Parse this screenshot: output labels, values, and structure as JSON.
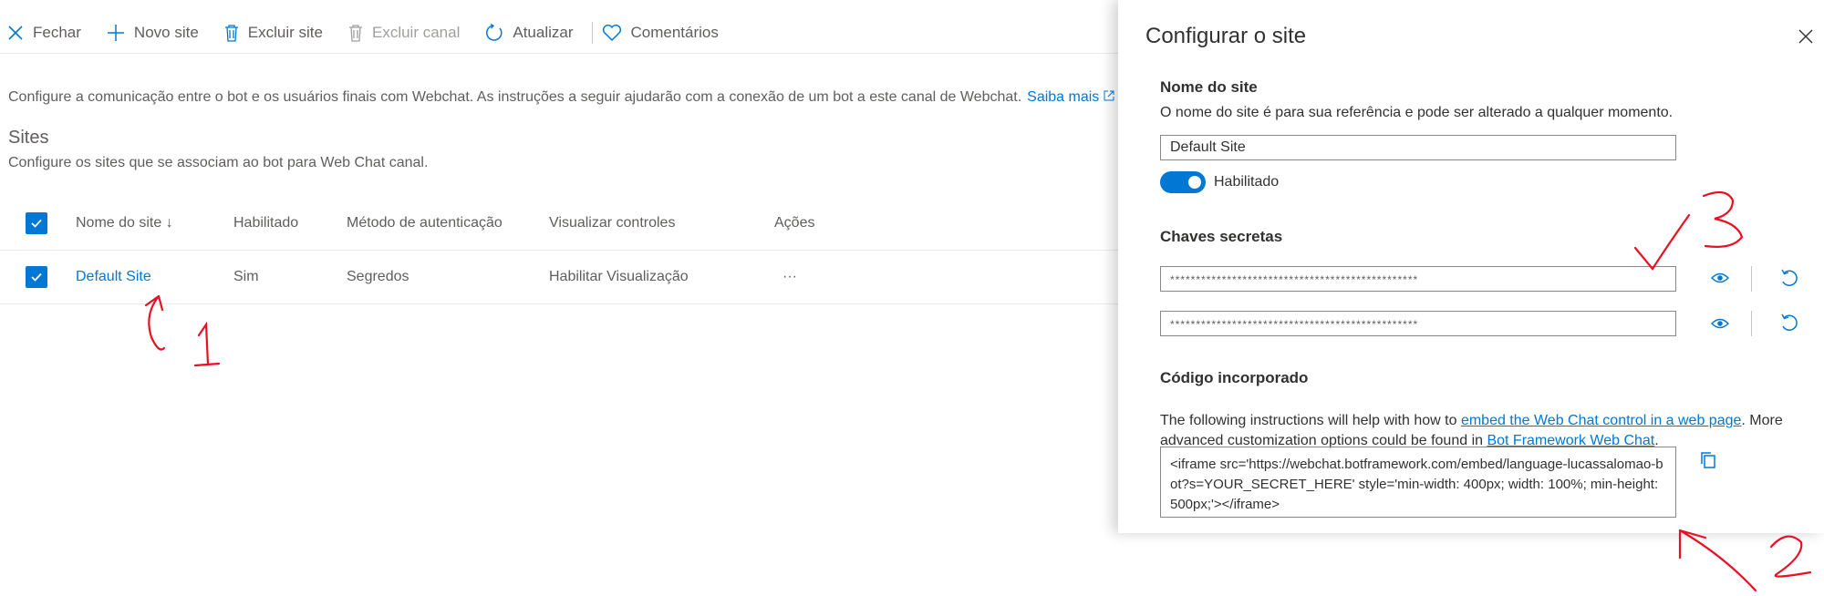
{
  "toolbar": {
    "items": [
      {
        "label": "Fechar",
        "icon": "close-icon"
      },
      {
        "label": "Novo site",
        "icon": "plus-icon"
      },
      {
        "label": "Excluir site",
        "icon": "trash-icon"
      },
      {
        "label": "Excluir canal",
        "icon": "trash-icon",
        "disabled": true
      },
      {
        "label": "Atualizar",
        "icon": "refresh-icon"
      },
      {
        "label": "Comentários",
        "icon": "heart-icon"
      }
    ]
  },
  "main": {
    "intro": "Configure a comunicação entre o bot e os usuários finais com Webchat. As instruções a seguir ajudarão com a conexão de um bot a este canal de Webchat.",
    "learn_more": "Saiba mais",
    "sites_heading": "Sites",
    "sites_sub": "Configure os sites que se associam ao bot para Web Chat canal.",
    "table": {
      "headers": [
        "Nome do site ↓",
        "Habilitado",
        "Método de autenticação",
        "Visualizar controles",
        "Ações"
      ],
      "rows": [
        {
          "name": "Default Site",
          "enabled": "Sim",
          "auth": "Segredos",
          "preview": "Habilitar Visualização",
          "actions": "···"
        }
      ]
    }
  },
  "panel": {
    "title": "Configurar o site",
    "site_name_label": "Nome do site",
    "site_name_help": "O nome do site é para sua referência e pode ser alterado a qualquer momento.",
    "site_name_value": "Default Site",
    "enabled_label": "Habilitado",
    "enabled": true,
    "secret_keys_label": "Chaves secretas",
    "secret_1": "************************************************",
    "secret_2": "************************************************",
    "embed_label": "Código incorporado",
    "embed_text_1": "The following instructions will help with how to ",
    "embed_link_1": "embed the Web Chat control in a web page",
    "embed_text_2": ". More advanced customization options could be found in ",
    "embed_link_2": "Bot Framework Web Chat",
    "embed_text_3": ".",
    "embed_code": "<iframe src='https://webchat.botframework.com/embed/language-lucassalomao-bot?s=YOUR_SECRET_HERE'  style='min-width: 400px; width: 100%; min-height: 500px;'></iframe>"
  },
  "annotations": [
    "1",
    "2",
    "3"
  ],
  "colors": {
    "accent": "#0078d4",
    "annotation": "#e81123"
  }
}
